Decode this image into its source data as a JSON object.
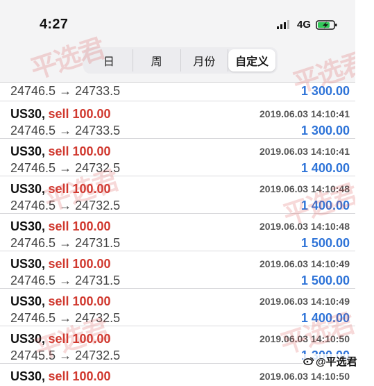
{
  "status_bar": {
    "time": "4:27",
    "network": "4G"
  },
  "tabs": [
    {
      "label": "日",
      "active": false
    },
    {
      "label": "周",
      "active": false
    },
    {
      "label": "月份",
      "active": false
    },
    {
      "label": "自定义",
      "active": true
    }
  ],
  "first_trade": {
    "prices": "24746.5 → 24733.5",
    "profit": "1 300.00"
  },
  "trades": [
    {
      "symbol": "US30,",
      "side": "sell 100.00",
      "datetime": "2019.06.03 14:10:41",
      "prices": "24746.5 → 24733.5",
      "profit": "1 300.00"
    },
    {
      "symbol": "US30,",
      "side": "sell 100.00",
      "datetime": "2019.06.03 14:10:41",
      "prices": "24746.5 → 24732.5",
      "profit": "1 400.00"
    },
    {
      "symbol": "US30,",
      "side": "sell 100.00",
      "datetime": "2019.06.03 14:10:48",
      "prices": "24746.5 → 24732.5",
      "profit": "1 400.00"
    },
    {
      "symbol": "US30,",
      "side": "sell 100.00",
      "datetime": "2019.06.03 14:10:48",
      "prices": "24746.5 → 24731.5",
      "profit": "1 500.00"
    },
    {
      "symbol": "US30,",
      "side": "sell 100.00",
      "datetime": "2019.06.03 14:10:49",
      "prices": "24746.5 → 24731.5",
      "profit": "1 500.00"
    },
    {
      "symbol": "US30,",
      "side": "sell 100.00",
      "datetime": "2019.06.03 14:10:49",
      "prices": "24746.5 → 24732.5",
      "profit": "1 400.00"
    },
    {
      "symbol": "US30,",
      "side": "sell 100.00",
      "datetime": "2019.06.03 14:10:50",
      "prices": "24745.5 → 24732.5",
      "profit": "1 300.00"
    },
    {
      "symbol": "US30,",
      "side": "sell 100.00",
      "datetime": "2019.06.03 14:10:50",
      "prices": "",
      "profit": ""
    }
  ],
  "watermark": {
    "text": "平选君"
  },
  "brand_footer": {
    "text": "@平选君"
  },
  "colors": {
    "sell": "#d0382e",
    "profit": "#2f74d8",
    "watermark": "#dc5050"
  },
  "icons": [
    "signal-icon",
    "battery-charging-icon",
    "weibo-icon"
  ]
}
